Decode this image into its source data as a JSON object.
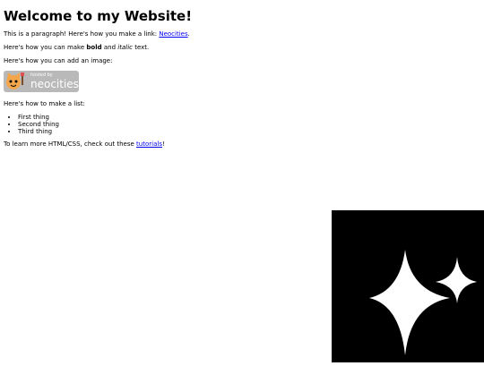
{
  "page": {
    "title": "Welcome to my Website!",
    "intro": {
      "before_link": "This is a paragraph! Here's how you make a link: ",
      "link": "Neocities",
      "after_link": "."
    },
    "formatting": {
      "before_bold": "Here's how you can make ",
      "bold": "bold",
      "middle": " and ",
      "italic": "italic",
      "after": " text."
    },
    "image_intro": "Here's how you can add an image:",
    "badge": {
      "small_text": "hosted by",
      "brand_text": "neocities"
    },
    "list_intro": "Here's how to make a list:",
    "list_items": [
      "First thing",
      "Second thing",
      "Third thing"
    ],
    "outro": {
      "before_link": "To learn more HTML/CSS, check out these ",
      "link": "tutorials",
      "after_link": "!"
    }
  },
  "colors": {
    "link": "#0000ee",
    "badge_background": "#b9b9b9",
    "sparkle_background": "#000000",
    "sparkle_fill": "#ffffff"
  },
  "icons": {
    "badge_mascot": "cat-mascot-icon",
    "sparkle": "sparkle-icon"
  }
}
